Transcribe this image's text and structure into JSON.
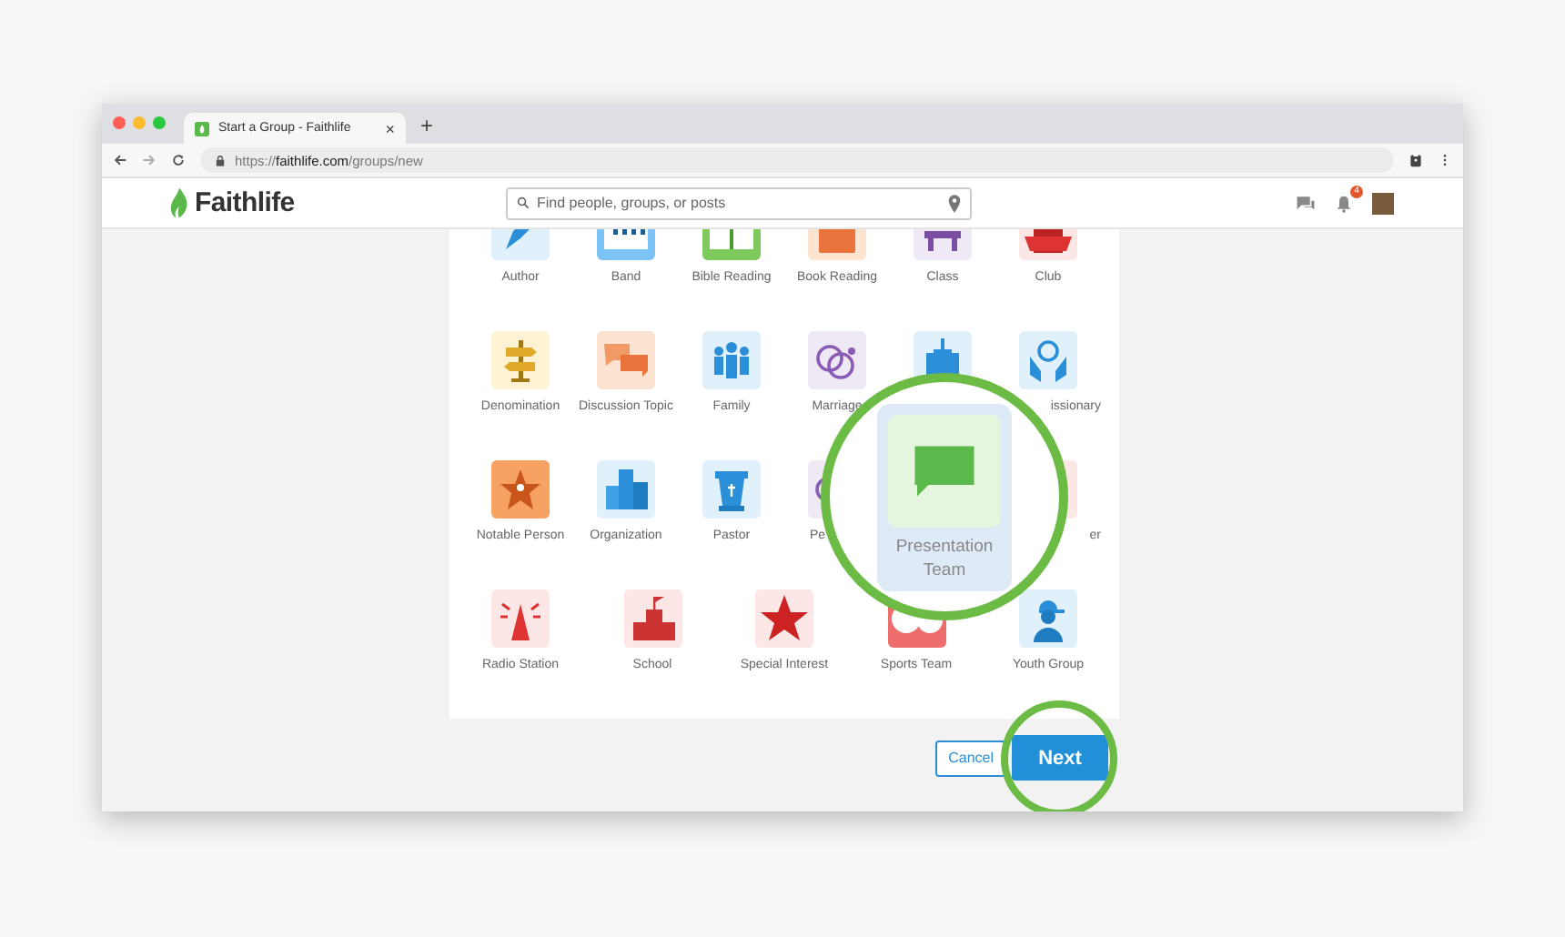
{
  "browser": {
    "tab_title": "Start a Group - Faithlife",
    "tab_close": "×",
    "new_tab": "+",
    "url": {
      "scheme": "https://",
      "host": "faithlife.com",
      "path": "/groups/new"
    }
  },
  "header": {
    "logo": "Faithlife",
    "search": {
      "placeholder": "Find people, groups, or posts"
    },
    "notification_count": "4"
  },
  "grid": [
    [
      {
        "kind": "pen",
        "label": "Author"
      },
      {
        "kind": "piano",
        "label": "Band"
      },
      {
        "kind": "bible",
        "label": "Bible Reading"
      },
      {
        "kind": "book",
        "label": "Book Reading"
      },
      {
        "kind": "desk",
        "label": "Class"
      },
      {
        "kind": "banner",
        "label": "Club"
      }
    ],
    [
      {
        "kind": "signpost",
        "label": "Denomination"
      },
      {
        "kind": "chat2",
        "label": "Discussion Topic"
      },
      {
        "kind": "people",
        "label": "Family"
      },
      {
        "kind": "rings",
        "label": "Marriage"
      },
      {
        "kind": "church"
      },
      {
        "kind": "globe",
        "label": "issionary"
      }
    ],
    [
      {
        "kind": "star-person",
        "label": "Notable Person"
      },
      {
        "kind": "buildings",
        "label": "Organization"
      },
      {
        "kind": "pulpit",
        "label": "Pastor"
      },
      {
        "kind": "purple",
        "label": "Pe"
      },
      {
        "kind": "pink",
        "label": "er"
      }
    ],
    [
      {
        "kind": "tower",
        "label": "Radio Station"
      },
      {
        "kind": "school",
        "label": "School"
      },
      {
        "kind": "star",
        "label": "Special Interest"
      },
      {
        "kind": "sports",
        "label": "Sports Team"
      },
      {
        "kind": "youth",
        "label": "Youth Group"
      }
    ]
  ],
  "magnifier": {
    "kind": "bubble",
    "label": "Presentation Team",
    "selected": true
  },
  "buttons": {
    "cancel": "Cancel",
    "next": "Next"
  }
}
